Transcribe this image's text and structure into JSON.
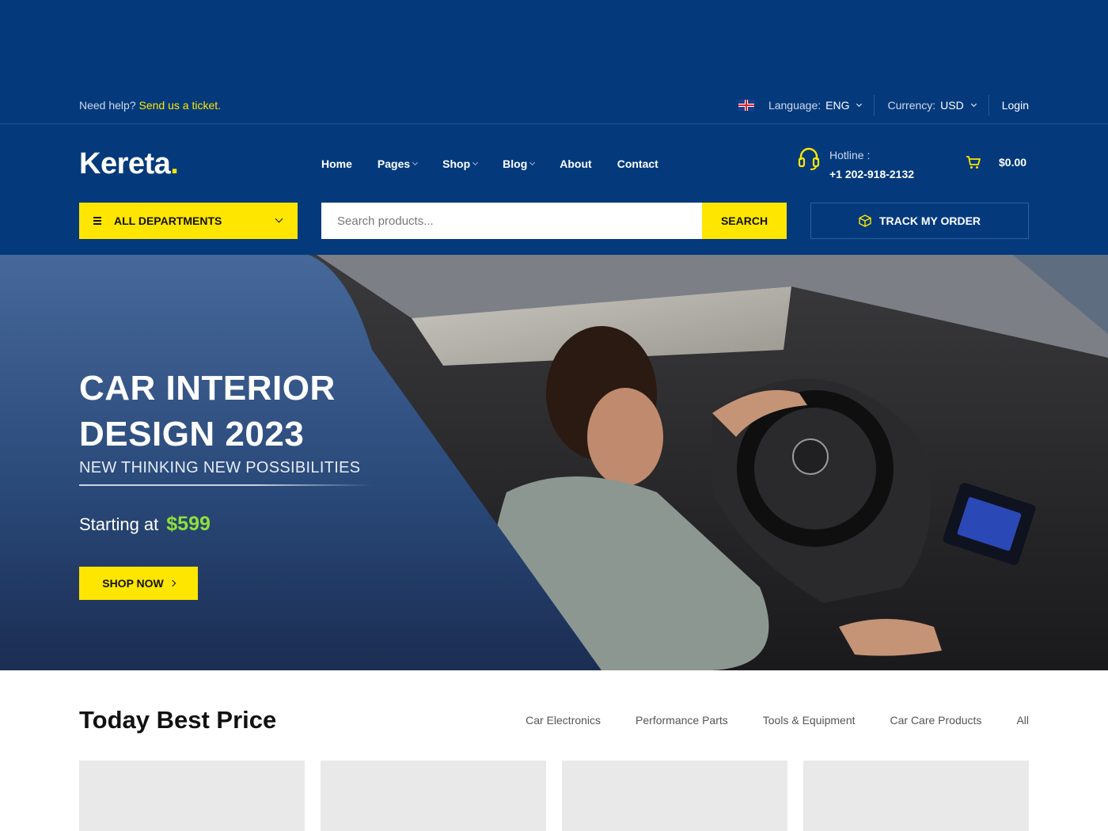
{
  "topbar": {
    "help_text": "Need help?",
    "help_link": "Send us a ticket.",
    "language_label": "Language:",
    "language_value": "ENG",
    "currency_label": "Currency:",
    "currency_value": "USD",
    "login": "Login"
  },
  "brand": {
    "name": "Kereta",
    "dot": "."
  },
  "nav": {
    "home": "Home",
    "pages": "Pages",
    "shop": "Shop",
    "blog": "Blog",
    "about": "About",
    "contact": "Contact"
  },
  "hotline": {
    "label": "Hotline :",
    "number": "+1 202-918-2132"
  },
  "cart": {
    "total": "$0.00"
  },
  "departments": {
    "label": "ALL DEPARTMENTS"
  },
  "search": {
    "placeholder": "Search products...",
    "button": "SEARCH"
  },
  "track": {
    "label": "TRACK MY ORDER"
  },
  "hero": {
    "title": "CAR INTERIOR DESIGN 2023",
    "subtitle": "NEW THINKING NEW POSSIBILITIES",
    "price_label": "Starting at",
    "price": "$599",
    "cta": "SHOP NOW"
  },
  "best_price": {
    "title": "Today Best Price",
    "tabs": [
      "Car Electronics",
      "Performance Parts",
      "Tools & Equipment",
      "Car Care Products",
      "All"
    ]
  },
  "colors": {
    "primary": "#043a7c",
    "accent": "#ffe600",
    "price_green": "#8ee03a"
  },
  "icons": {
    "flag": "uk-flag-icon",
    "hotline": "headset-icon",
    "cart": "cart-icon",
    "departments": "menu-icon",
    "track": "box-icon"
  }
}
